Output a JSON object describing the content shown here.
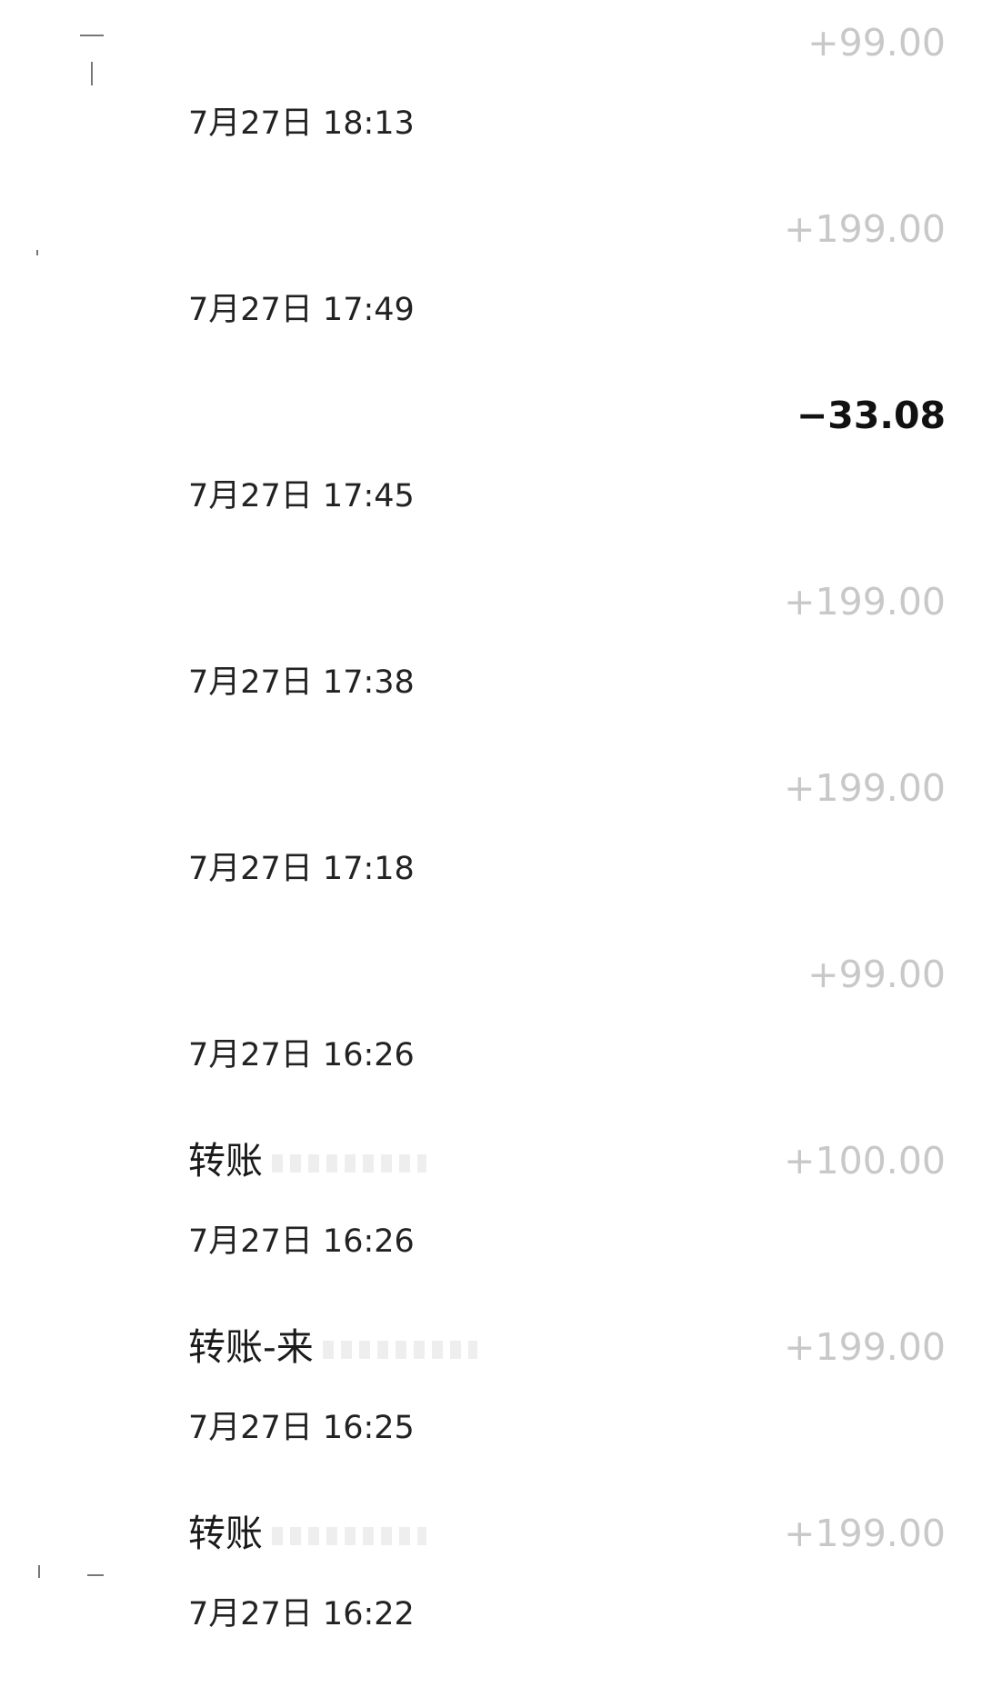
{
  "transactions": [
    {
      "title": "",
      "time": "7月27日 18:13",
      "amount": "+99.00",
      "kind": "income"
    },
    {
      "title": "",
      "time": "7月27日 17:49",
      "amount": "+199.00",
      "kind": "income"
    },
    {
      "title": "",
      "time": "7月27日 17:45",
      "amount": "−33.08",
      "kind": "expense"
    },
    {
      "title": "",
      "time": "7月27日 17:38",
      "amount": "+199.00",
      "kind": "income"
    },
    {
      "title": "",
      "time": "7月27日 17:18",
      "amount": "+199.00",
      "kind": "income"
    },
    {
      "title": "",
      "time": "7月27日 16:26",
      "amount": "+99.00",
      "kind": "income"
    },
    {
      "title": "转账",
      "time": "7月27日 16:26",
      "amount": "+100.00",
      "kind": "income"
    },
    {
      "title": "转账-来",
      "time": "7月27日 16:25",
      "amount": "+199.00",
      "kind": "income"
    },
    {
      "title": "转账",
      "time": "7月27日 16:22",
      "amount": "+199.00",
      "kind": "income"
    }
  ],
  "colors": {
    "income_amount": "#c8c8c8",
    "expense_amount": "#111111",
    "text": "#1a1a1a",
    "background": "#ffffff"
  }
}
